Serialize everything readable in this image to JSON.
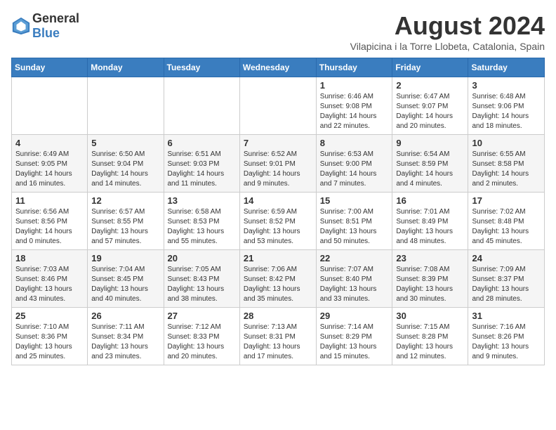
{
  "logo": {
    "general": "General",
    "blue": "Blue"
  },
  "title": {
    "month_year": "August 2024",
    "location": "Vilapicina i la Torre Llobeta, Catalonia, Spain"
  },
  "headers": [
    "Sunday",
    "Monday",
    "Tuesday",
    "Wednesday",
    "Thursday",
    "Friday",
    "Saturday"
  ],
  "weeks": [
    [
      {
        "day": "",
        "detail": ""
      },
      {
        "day": "",
        "detail": ""
      },
      {
        "day": "",
        "detail": ""
      },
      {
        "day": "",
        "detail": ""
      },
      {
        "day": "1",
        "detail": "Sunrise: 6:46 AM\nSunset: 9:08 PM\nDaylight: 14 hours\nand 22 minutes."
      },
      {
        "day": "2",
        "detail": "Sunrise: 6:47 AM\nSunset: 9:07 PM\nDaylight: 14 hours\nand 20 minutes."
      },
      {
        "day": "3",
        "detail": "Sunrise: 6:48 AM\nSunset: 9:06 PM\nDaylight: 14 hours\nand 18 minutes."
      }
    ],
    [
      {
        "day": "4",
        "detail": "Sunrise: 6:49 AM\nSunset: 9:05 PM\nDaylight: 14 hours\nand 16 minutes."
      },
      {
        "day": "5",
        "detail": "Sunrise: 6:50 AM\nSunset: 9:04 PM\nDaylight: 14 hours\nand 14 minutes."
      },
      {
        "day": "6",
        "detail": "Sunrise: 6:51 AM\nSunset: 9:03 PM\nDaylight: 14 hours\nand 11 minutes."
      },
      {
        "day": "7",
        "detail": "Sunrise: 6:52 AM\nSunset: 9:01 PM\nDaylight: 14 hours\nand 9 minutes."
      },
      {
        "day": "8",
        "detail": "Sunrise: 6:53 AM\nSunset: 9:00 PM\nDaylight: 14 hours\nand 7 minutes."
      },
      {
        "day": "9",
        "detail": "Sunrise: 6:54 AM\nSunset: 8:59 PM\nDaylight: 14 hours\nand 4 minutes."
      },
      {
        "day": "10",
        "detail": "Sunrise: 6:55 AM\nSunset: 8:58 PM\nDaylight: 14 hours\nand 2 minutes."
      }
    ],
    [
      {
        "day": "11",
        "detail": "Sunrise: 6:56 AM\nSunset: 8:56 PM\nDaylight: 14 hours\nand 0 minutes."
      },
      {
        "day": "12",
        "detail": "Sunrise: 6:57 AM\nSunset: 8:55 PM\nDaylight: 13 hours\nand 57 minutes."
      },
      {
        "day": "13",
        "detail": "Sunrise: 6:58 AM\nSunset: 8:53 PM\nDaylight: 13 hours\nand 55 minutes."
      },
      {
        "day": "14",
        "detail": "Sunrise: 6:59 AM\nSunset: 8:52 PM\nDaylight: 13 hours\nand 53 minutes."
      },
      {
        "day": "15",
        "detail": "Sunrise: 7:00 AM\nSunset: 8:51 PM\nDaylight: 13 hours\nand 50 minutes."
      },
      {
        "day": "16",
        "detail": "Sunrise: 7:01 AM\nSunset: 8:49 PM\nDaylight: 13 hours\nand 48 minutes."
      },
      {
        "day": "17",
        "detail": "Sunrise: 7:02 AM\nSunset: 8:48 PM\nDaylight: 13 hours\nand 45 minutes."
      }
    ],
    [
      {
        "day": "18",
        "detail": "Sunrise: 7:03 AM\nSunset: 8:46 PM\nDaylight: 13 hours\nand 43 minutes."
      },
      {
        "day": "19",
        "detail": "Sunrise: 7:04 AM\nSunset: 8:45 PM\nDaylight: 13 hours\nand 40 minutes."
      },
      {
        "day": "20",
        "detail": "Sunrise: 7:05 AM\nSunset: 8:43 PM\nDaylight: 13 hours\nand 38 minutes."
      },
      {
        "day": "21",
        "detail": "Sunrise: 7:06 AM\nSunset: 8:42 PM\nDaylight: 13 hours\nand 35 minutes."
      },
      {
        "day": "22",
        "detail": "Sunrise: 7:07 AM\nSunset: 8:40 PM\nDaylight: 13 hours\nand 33 minutes."
      },
      {
        "day": "23",
        "detail": "Sunrise: 7:08 AM\nSunset: 8:39 PM\nDaylight: 13 hours\nand 30 minutes."
      },
      {
        "day": "24",
        "detail": "Sunrise: 7:09 AM\nSunset: 8:37 PM\nDaylight: 13 hours\nand 28 minutes."
      }
    ],
    [
      {
        "day": "25",
        "detail": "Sunrise: 7:10 AM\nSunset: 8:36 PM\nDaylight: 13 hours\nand 25 minutes."
      },
      {
        "day": "26",
        "detail": "Sunrise: 7:11 AM\nSunset: 8:34 PM\nDaylight: 13 hours\nand 23 minutes."
      },
      {
        "day": "27",
        "detail": "Sunrise: 7:12 AM\nSunset: 8:33 PM\nDaylight: 13 hours\nand 20 minutes."
      },
      {
        "day": "28",
        "detail": "Sunrise: 7:13 AM\nSunset: 8:31 PM\nDaylight: 13 hours\nand 17 minutes."
      },
      {
        "day": "29",
        "detail": "Sunrise: 7:14 AM\nSunset: 8:29 PM\nDaylight: 13 hours\nand 15 minutes."
      },
      {
        "day": "30",
        "detail": "Sunrise: 7:15 AM\nSunset: 8:28 PM\nDaylight: 13 hours\nand 12 minutes."
      },
      {
        "day": "31",
        "detail": "Sunrise: 7:16 AM\nSunset: 8:26 PM\nDaylight: 13 hours\nand 9 minutes."
      }
    ]
  ]
}
